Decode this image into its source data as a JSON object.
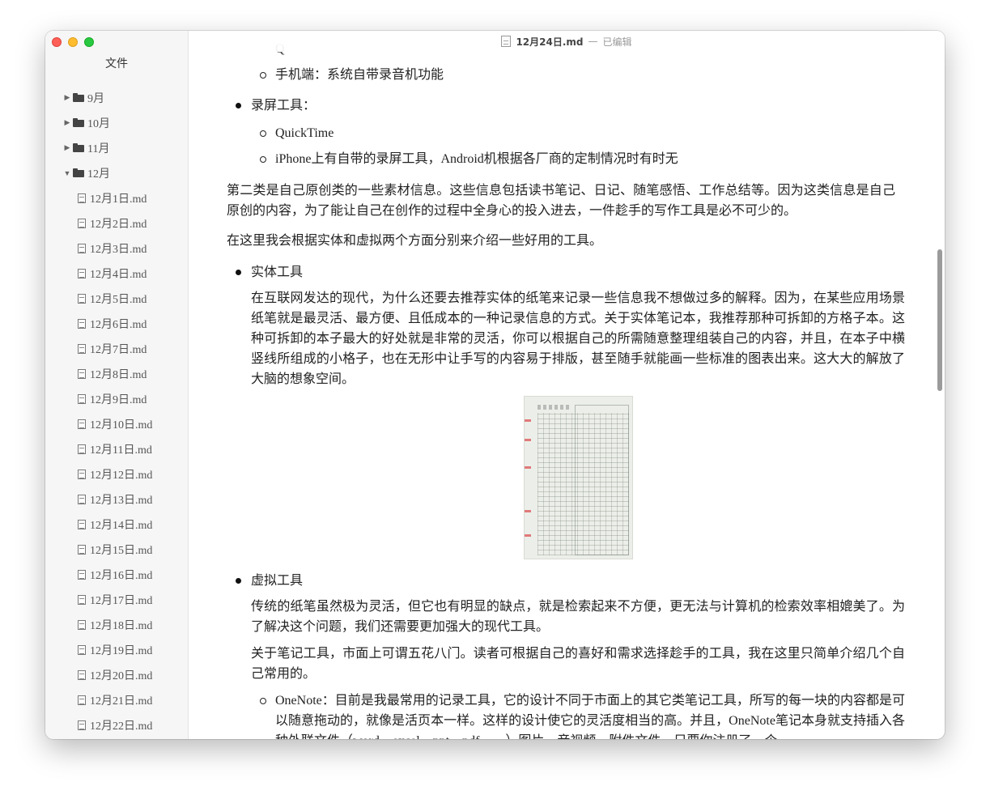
{
  "window": {
    "title": "12月24日.md",
    "separator": "—",
    "status": "已编辑"
  },
  "sidebar": {
    "title": "文件",
    "folders": [
      {
        "label": "9月",
        "expanded": false
      },
      {
        "label": "10月",
        "expanded": false
      },
      {
        "label": "11月",
        "expanded": false
      },
      {
        "label": "12月",
        "expanded": true
      }
    ],
    "files": [
      "12月1日.md",
      "12月2日.md",
      "12月3日.md",
      "12月4日.md",
      "12月5日.md",
      "12月6日.md",
      "12月7日.md",
      "12月8日.md",
      "12月9日.md",
      "12月10日.md",
      "12月11日.md",
      "12月12日.md",
      "12月13日.md",
      "12月14日.md",
      "12月15日.md",
      "12月16日.md",
      "12月17日.md",
      "12月18日.md",
      "12月19日.md",
      "12月20日.md",
      "12月21日.md",
      "12月22日.md"
    ]
  },
  "doc": {
    "partial_top": "Q",
    "item_phone": "手机端：系统自带录音机功能",
    "screen_heading": "录屏工具：",
    "screen_items": [
      "QuickTime",
      "iPhone上有自带的录屏工具，Android机根据各厂商的定制情况时有时无"
    ],
    "para_original": "第二类是自己原创类的一些素材信息。这些信息包括读书笔记、日记、随笔感悟、工作总结等。因为这类信息是自己原创的内容，为了能让自己在创作的过程中全身心的投入进去，一件趁手的写作工具是必不可少的。",
    "para_intro": "在这里我会根据实体和虚拟两个方面分别来介绍一些好用的工具。",
    "physical_heading": "实体工具",
    "physical_text": "在互联网发达的现代，为什么还要去推荐实体的纸笔来记录一些信息我不想做过多的解释。因为，在某些应用场景纸笔就是最灵活、最方便、且低成本的一种记录信息的方式。关于实体笔记本，我推荐那种可拆卸的方格子本。这种可拆卸的本子最大的好处就是非常的灵活，你可以根据自己的所需随意整理组装自己的内容，并且，在本子中横竖线所组成的小格子，也在无形中让手写的内容易于排版，甚至随手就能画一些标准的图表出来。这大大的解放了大脑的想象空间。",
    "virtual_heading": "虚拟工具",
    "virtual_text1": "传统的纸笔虽然极为灵活，但它也有明显的缺点，就是检索起来不方便，更无法与计算机的检索效率相媲美了。为了解决这个问题，我们还需要更加强大的现代工具。",
    "virtual_text2": "关于笔记工具，市面上可谓五花八门。读者可根据自己的喜好和需求选择趁手的工具，我在这里只简单介绍几个自己常用的。",
    "onenote_text": "OneNote：目前是我最常用的记录工具，它的设计不同于市面上的其它类笔记工具，所写的每一块的内容都是可以随意拖动的，就像是活页本一样。这样的设计使它的灵活度相当的高。并且，OneNote笔记本身就支持插入各种外联文件（word、excel、ppt、pdf……）图片、音视频、附件文件，只要你注册了一个"
  }
}
